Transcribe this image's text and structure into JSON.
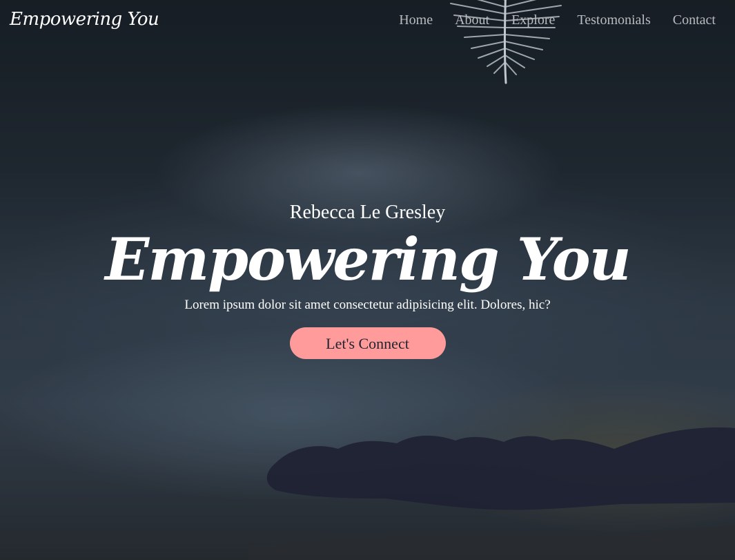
{
  "nav": {
    "brand": "Empowering You",
    "links": [
      "Home",
      "About",
      "Explore",
      "Testomonials",
      "Contact"
    ]
  },
  "hero": {
    "author": "Rebecca Le Gresley",
    "title": "Empowering You",
    "subtitle": "Lorem ipsum dolor sit amet consectetur adipisicing elit. Dolores, hic?",
    "cta_label": "Let's Connect"
  },
  "colors": {
    "accent": "#ff9b9b",
    "nav_text": "#b8bcc0",
    "text": "#ffffff",
    "button_text": "#1f2530"
  },
  "images": {
    "top": "feather-image",
    "bottom": "open-hand-image"
  }
}
